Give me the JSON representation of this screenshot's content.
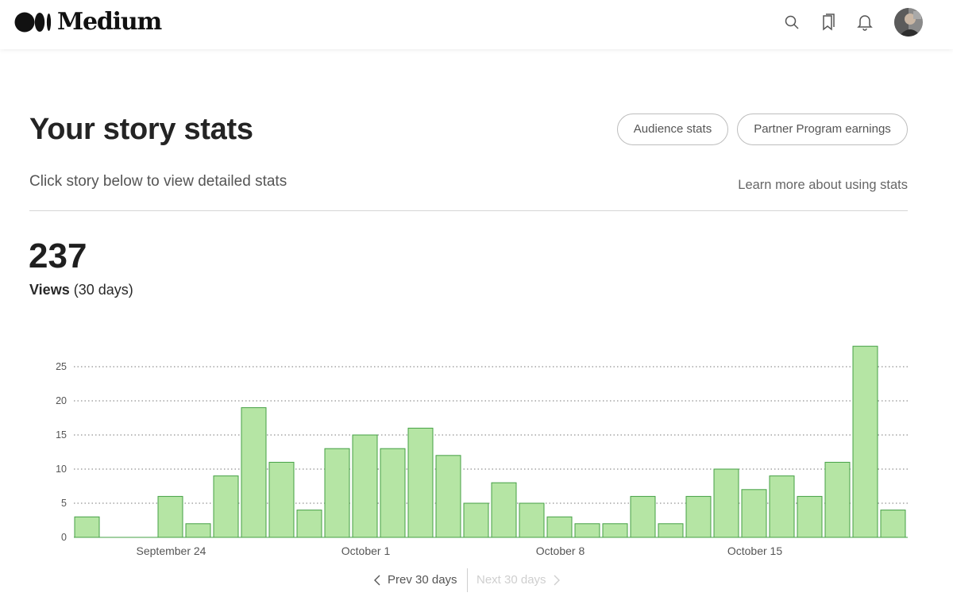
{
  "header": {
    "logo_text": "Medium",
    "icons": [
      "search-icon",
      "bookmarks-icon",
      "bell-icon",
      "avatar"
    ]
  },
  "page": {
    "title": "Your story stats",
    "audience_stats_label": "Audience stats",
    "partner_program_label": "Partner Program earnings",
    "subtitle": "Click story below to view detailed stats",
    "learn_more_label": "Learn more about using stats"
  },
  "stats": {
    "views_total": "237",
    "views_label": "Views",
    "views_period": "(30 days)"
  },
  "pagination": {
    "prev_label": "Prev 30 days",
    "next_label": "Next 30 days"
  },
  "colors": {
    "bar_fill": "#b5e5a4",
    "bar_stroke": "#45a045",
    "grid": "#777777",
    "axis_text": "#555555"
  },
  "chart_data": {
    "type": "bar",
    "x": [
      "Sep 21",
      "Sep 22",
      "Sep 23",
      "Sep 24",
      "Sep 25",
      "Sep 26",
      "Sep 27",
      "Sep 28",
      "Sep 29",
      "Sep 30",
      "Oct 1",
      "Oct 2",
      "Oct 3",
      "Oct 4",
      "Oct 5",
      "Oct 6",
      "Oct 7",
      "Oct 8",
      "Oct 9",
      "Oct 10",
      "Oct 11",
      "Oct 12",
      "Oct 13",
      "Oct 14",
      "Oct 15",
      "Oct 16",
      "Oct 17",
      "Oct 18",
      "Oct 19",
      "Oct 20"
    ],
    "values": [
      3,
      0,
      0,
      6,
      2,
      9,
      19,
      11,
      4,
      13,
      15,
      13,
      16,
      12,
      5,
      8,
      5,
      3,
      2,
      2,
      6,
      2,
      6,
      10,
      7,
      9,
      6,
      11,
      28,
      4
    ],
    "x_tick_labels": [
      {
        "label": "September 24",
        "index": 3
      },
      {
        "label": "October 1",
        "index": 10
      },
      {
        "label": "October 8",
        "index": 17
      },
      {
        "label": "October 15",
        "index": 24
      }
    ],
    "y_ticks": [
      0,
      5,
      10,
      15,
      20,
      25
    ],
    "ylim": [
      0,
      28
    ],
    "grid": true,
    "title": "",
    "xlabel": "",
    "ylabel": ""
  }
}
